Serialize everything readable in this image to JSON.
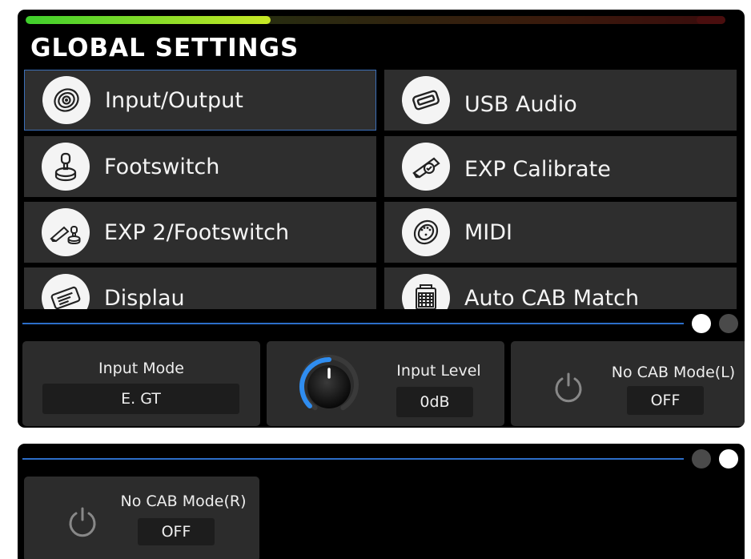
{
  "app": {
    "title": "GLOBAL SETTINGS"
  },
  "meter": {
    "level": 0.35,
    "colors": {
      "low": "#3fcf2c",
      "high": "#c8e825",
      "peak": "#4a0e0e"
    }
  },
  "accent_color": "#2c6ec9",
  "menu": {
    "items": [
      {
        "label": "Input/Output",
        "icon": "jack-socket-icon",
        "selected": true
      },
      {
        "label": "USB Audio",
        "icon": "usb-port-icon",
        "selected": false
      },
      {
        "label": "Footswitch",
        "icon": "footswitch-icon",
        "selected": false
      },
      {
        "label": "EXP Calibrate",
        "icon": "expression-pedal-icon",
        "selected": false
      },
      {
        "label": "EXP 2/Footswitch",
        "icon": "pedal-footswitch-icon",
        "selected": false
      },
      {
        "label": "MIDI",
        "icon": "midi-port-icon",
        "selected": false
      },
      {
        "label": "Displau",
        "icon": "display-icon",
        "selected": false
      },
      {
        "label": "Auto CAB Match",
        "icon": "cabinet-icon",
        "selected": false
      }
    ]
  },
  "param_page_1": {
    "active_dot": 0,
    "input_mode": {
      "label": "Input Mode",
      "value": "E. GT"
    },
    "input_level": {
      "label": "Input Level",
      "value": "0dB",
      "knob_level": 0.5
    },
    "no_cab_l": {
      "label": "No CAB Mode(L)",
      "value": "OFF",
      "icon": "power-icon"
    }
  },
  "param_page_2": {
    "active_dot": 1,
    "no_cab_r": {
      "label": "No CAB Mode(R)",
      "value": "OFF",
      "icon": "power-icon"
    }
  }
}
